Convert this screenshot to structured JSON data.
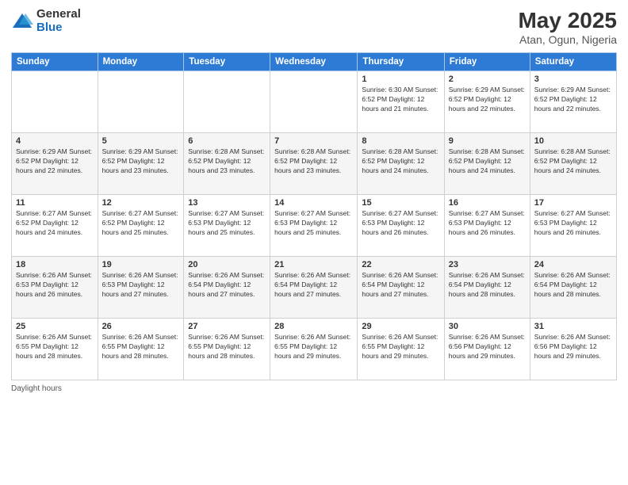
{
  "logo": {
    "general": "General",
    "blue": "Blue"
  },
  "title": {
    "month": "May 2025",
    "location": "Atan, Ogun, Nigeria"
  },
  "days_of_week": [
    "Sunday",
    "Monday",
    "Tuesday",
    "Wednesday",
    "Thursday",
    "Friday",
    "Saturday"
  ],
  "footer": {
    "daylight_hours": "Daylight hours"
  },
  "weeks": [
    [
      {
        "day": "",
        "info": ""
      },
      {
        "day": "",
        "info": ""
      },
      {
        "day": "",
        "info": ""
      },
      {
        "day": "",
        "info": ""
      },
      {
        "day": "1",
        "info": "Sunrise: 6:30 AM\nSunset: 6:52 PM\nDaylight: 12 hours\nand 21 minutes."
      },
      {
        "day": "2",
        "info": "Sunrise: 6:29 AM\nSunset: 6:52 PM\nDaylight: 12 hours\nand 22 minutes."
      },
      {
        "day": "3",
        "info": "Sunrise: 6:29 AM\nSunset: 6:52 PM\nDaylight: 12 hours\nand 22 minutes."
      }
    ],
    [
      {
        "day": "4",
        "info": "Sunrise: 6:29 AM\nSunset: 6:52 PM\nDaylight: 12 hours\nand 22 minutes."
      },
      {
        "day": "5",
        "info": "Sunrise: 6:29 AM\nSunset: 6:52 PM\nDaylight: 12 hours\nand 23 minutes."
      },
      {
        "day": "6",
        "info": "Sunrise: 6:28 AM\nSunset: 6:52 PM\nDaylight: 12 hours\nand 23 minutes."
      },
      {
        "day": "7",
        "info": "Sunrise: 6:28 AM\nSunset: 6:52 PM\nDaylight: 12 hours\nand 23 minutes."
      },
      {
        "day": "8",
        "info": "Sunrise: 6:28 AM\nSunset: 6:52 PM\nDaylight: 12 hours\nand 24 minutes."
      },
      {
        "day": "9",
        "info": "Sunrise: 6:28 AM\nSunset: 6:52 PM\nDaylight: 12 hours\nand 24 minutes."
      },
      {
        "day": "10",
        "info": "Sunrise: 6:28 AM\nSunset: 6:52 PM\nDaylight: 12 hours\nand 24 minutes."
      }
    ],
    [
      {
        "day": "11",
        "info": "Sunrise: 6:27 AM\nSunset: 6:52 PM\nDaylight: 12 hours\nand 24 minutes."
      },
      {
        "day": "12",
        "info": "Sunrise: 6:27 AM\nSunset: 6:52 PM\nDaylight: 12 hours\nand 25 minutes."
      },
      {
        "day": "13",
        "info": "Sunrise: 6:27 AM\nSunset: 6:53 PM\nDaylight: 12 hours\nand 25 minutes."
      },
      {
        "day": "14",
        "info": "Sunrise: 6:27 AM\nSunset: 6:53 PM\nDaylight: 12 hours\nand 25 minutes."
      },
      {
        "day": "15",
        "info": "Sunrise: 6:27 AM\nSunset: 6:53 PM\nDaylight: 12 hours\nand 26 minutes."
      },
      {
        "day": "16",
        "info": "Sunrise: 6:27 AM\nSunset: 6:53 PM\nDaylight: 12 hours\nand 26 minutes."
      },
      {
        "day": "17",
        "info": "Sunrise: 6:27 AM\nSunset: 6:53 PM\nDaylight: 12 hours\nand 26 minutes."
      }
    ],
    [
      {
        "day": "18",
        "info": "Sunrise: 6:26 AM\nSunset: 6:53 PM\nDaylight: 12 hours\nand 26 minutes."
      },
      {
        "day": "19",
        "info": "Sunrise: 6:26 AM\nSunset: 6:53 PM\nDaylight: 12 hours\nand 27 minutes."
      },
      {
        "day": "20",
        "info": "Sunrise: 6:26 AM\nSunset: 6:54 PM\nDaylight: 12 hours\nand 27 minutes."
      },
      {
        "day": "21",
        "info": "Sunrise: 6:26 AM\nSunset: 6:54 PM\nDaylight: 12 hours\nand 27 minutes."
      },
      {
        "day": "22",
        "info": "Sunrise: 6:26 AM\nSunset: 6:54 PM\nDaylight: 12 hours\nand 27 minutes."
      },
      {
        "day": "23",
        "info": "Sunrise: 6:26 AM\nSunset: 6:54 PM\nDaylight: 12 hours\nand 28 minutes."
      },
      {
        "day": "24",
        "info": "Sunrise: 6:26 AM\nSunset: 6:54 PM\nDaylight: 12 hours\nand 28 minutes."
      }
    ],
    [
      {
        "day": "25",
        "info": "Sunrise: 6:26 AM\nSunset: 6:55 PM\nDaylight: 12 hours\nand 28 minutes."
      },
      {
        "day": "26",
        "info": "Sunrise: 6:26 AM\nSunset: 6:55 PM\nDaylight: 12 hours\nand 28 minutes."
      },
      {
        "day": "27",
        "info": "Sunrise: 6:26 AM\nSunset: 6:55 PM\nDaylight: 12 hours\nand 28 minutes."
      },
      {
        "day": "28",
        "info": "Sunrise: 6:26 AM\nSunset: 6:55 PM\nDaylight: 12 hours\nand 29 minutes."
      },
      {
        "day": "29",
        "info": "Sunrise: 6:26 AM\nSunset: 6:55 PM\nDaylight: 12 hours\nand 29 minutes."
      },
      {
        "day": "30",
        "info": "Sunrise: 6:26 AM\nSunset: 6:56 PM\nDaylight: 12 hours\nand 29 minutes."
      },
      {
        "day": "31",
        "info": "Sunrise: 6:26 AM\nSunset: 6:56 PM\nDaylight: 12 hours\nand 29 minutes."
      }
    ]
  ]
}
